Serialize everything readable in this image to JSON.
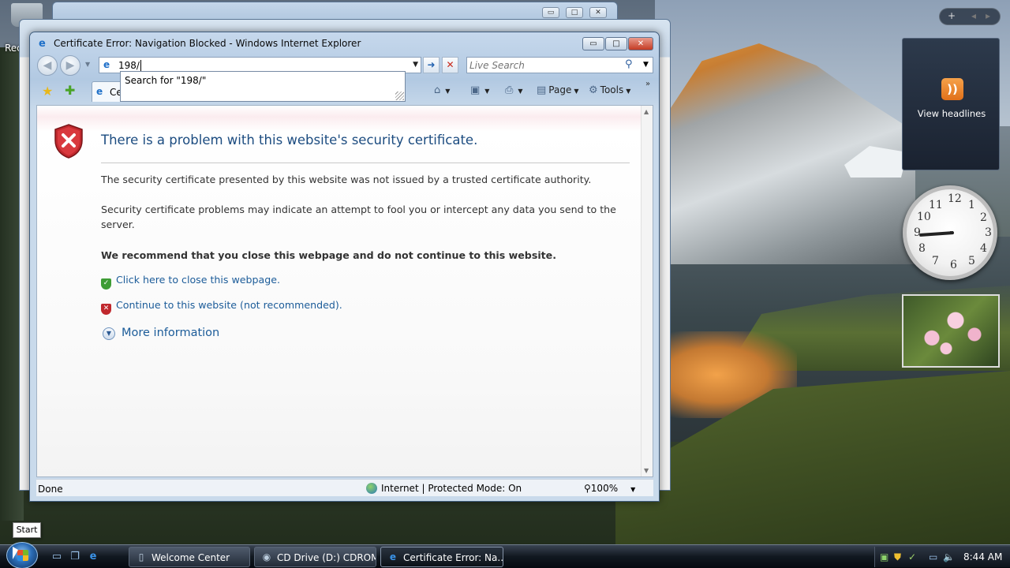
{
  "desktop": {
    "recycle_bin_label": "Rec",
    "start_tooltip": "Start"
  },
  "ie": {
    "title": "Certificate Error: Navigation Blocked - Windows Internet Explorer",
    "window_controls": {
      "minimize": "▭",
      "maximize": "□",
      "close": "✕"
    },
    "address_value": "198/",
    "autocomplete_item": "Search for \"198/\"",
    "search_placeholder": "Live Search",
    "tab_label": "Certificate Error: Navigation Blocked",
    "toolbar": {
      "page_label": "Page",
      "tools_label": "Tools"
    },
    "content": {
      "heading": "There is a problem with this website's security certificate.",
      "para1": "The security certificate presented by this website was not issued by a trusted certificate authority.",
      "para2": "Security certificate problems may indicate an attempt to fool you or intercept any data you send to the server.",
      "recommend": "We recommend that you close this webpage and do not continue to this website.",
      "close_link": "Click here to close this webpage.",
      "continue_link": "Continue to this website (not recommended).",
      "more_info": "More information"
    },
    "status": {
      "text": "Done",
      "zone": "Internet | Protected Mode: On",
      "zoom": "100%"
    }
  },
  "gadgets": {
    "feed_label": "View headlines",
    "clock_numbers": [
      "12",
      "1",
      "2",
      "3",
      "4",
      "5",
      "6",
      "7",
      "8",
      "9",
      "10",
      "11"
    ]
  },
  "taskbar": {
    "tasks": [
      {
        "label": "Welcome Center"
      },
      {
        "label": "CD Drive (D:) CDROM"
      },
      {
        "label": "Certificate Error: Na..."
      }
    ],
    "clock": "8:44 AM"
  },
  "colors": {
    "heading": "#1c4c80",
    "link": "#1c5c99",
    "shield_red": "#c0282d",
    "shield_green": "#3e9c35"
  },
  "icons": [
    "recycle-bin-icon",
    "ie-icon",
    "back-icon",
    "forward-icon",
    "go-icon",
    "stop-icon",
    "search-icon",
    "favorites-star-icon",
    "add-favorites-icon",
    "home-icon",
    "feeds-icon",
    "print-icon",
    "page-icon",
    "tools-gear-icon",
    "security-shield-icon",
    "globe-icon",
    "zoom-icon",
    "rss-icon",
    "windows-orb-icon"
  ]
}
